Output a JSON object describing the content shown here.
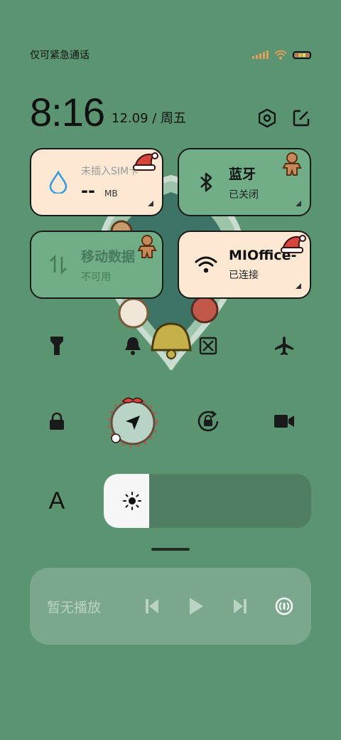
{
  "status_bar": {
    "carrier_text": "仅可紧急通话",
    "signal_icon": "signal-bars-icon",
    "wifi_icon": "wifi-icon",
    "battery_icon": "battery-icon"
  },
  "header": {
    "time": "8:16",
    "date": "12.09 / 周五",
    "settings_icon": "hexagon-settings-icon",
    "edit_icon": "edit-icon"
  },
  "tiles": {
    "data_usage": {
      "title": "未插入SIM卡",
      "value": "--",
      "unit": "MB",
      "state": "on"
    },
    "bluetooth": {
      "title": "蓝牙",
      "subtitle": "已关闭",
      "state": "off"
    },
    "mobile_data": {
      "title": "移动数据",
      "subtitle": "不可用",
      "state": "off"
    },
    "wifi": {
      "title": "MIOffice-",
      "subtitle": "已连接",
      "state": "on"
    }
  },
  "toggles_row1": [
    "flashlight-icon",
    "bell-icon",
    "screenshot-icon",
    "airplane-icon"
  ],
  "toggles_row2": [
    "lock-icon",
    "location-icon",
    "rotation-lock-icon",
    "video-icon"
  ],
  "brightness": {
    "auto_label": "A",
    "level_percent": 22
  },
  "media": {
    "title": "暂无播放",
    "controls": [
      "previous-icon",
      "play-icon",
      "next-icon",
      "cast-icon"
    ]
  },
  "colors": {
    "background": "#5a9470",
    "tile_on": "#fde9d3",
    "tile_off": "#6fae86"
  }
}
